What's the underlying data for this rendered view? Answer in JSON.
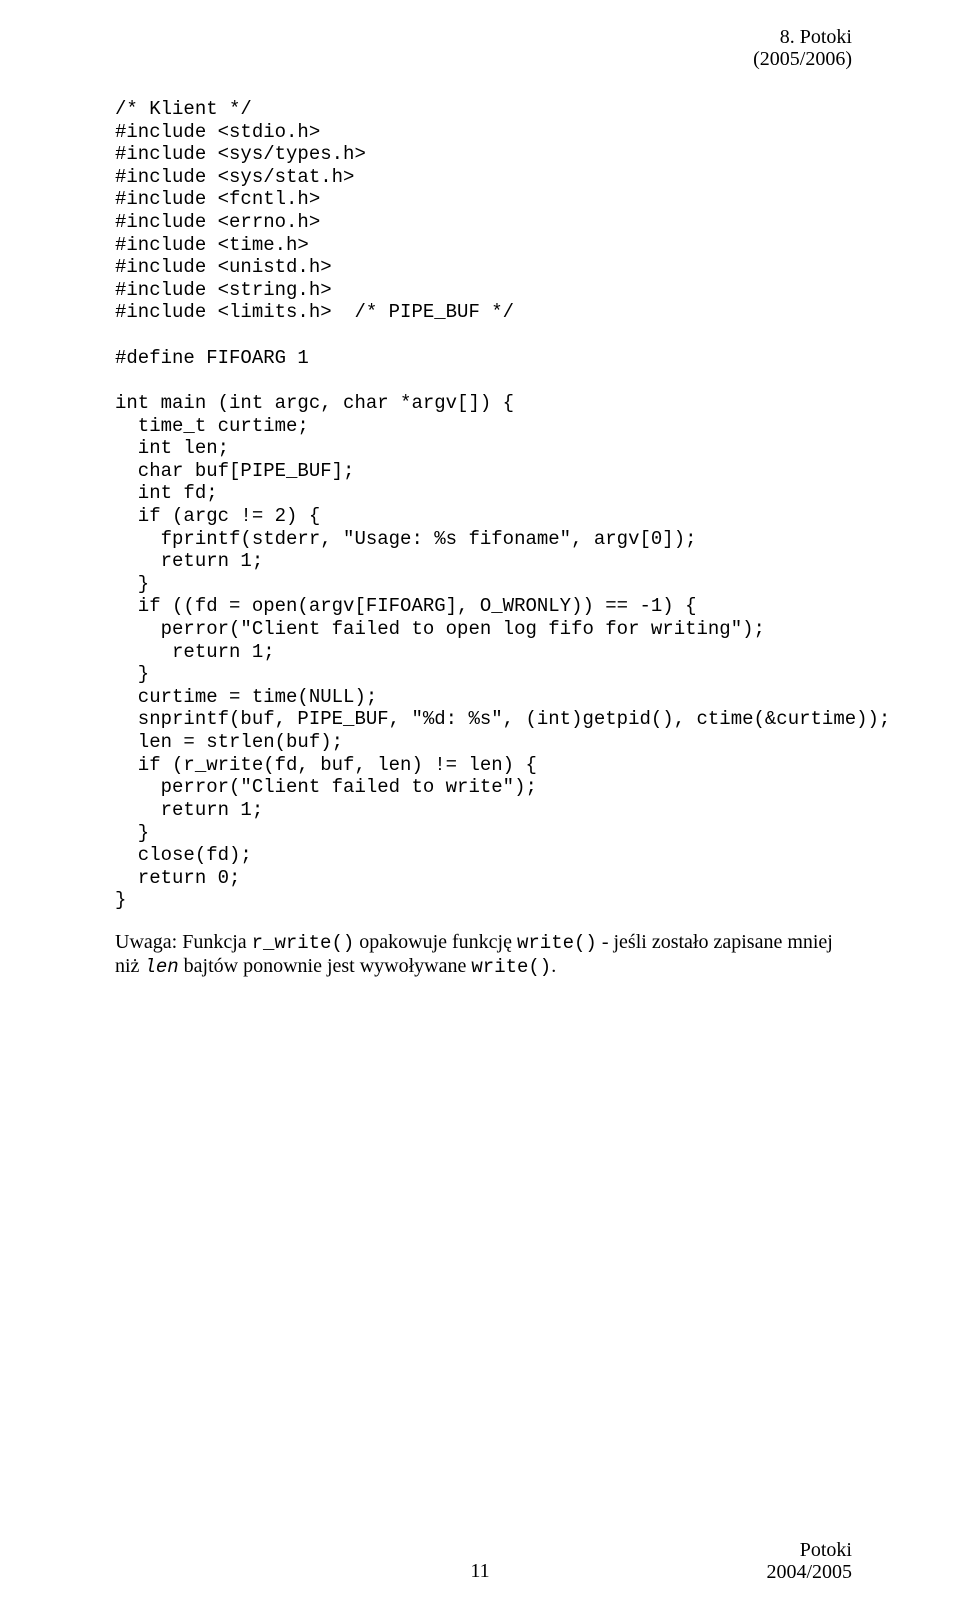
{
  "header": {
    "title": "8. Potoki",
    "year": "(2005/2006)"
  },
  "code": "/* Klient */\n#include <stdio.h>\n#include <sys/types.h>\n#include <sys/stat.h>\n#include <fcntl.h>\n#include <errno.h>\n#include <time.h>\n#include <unistd.h>\n#include <string.h>\n#include <limits.h>  /* PIPE_BUF */\n\n#define FIFOARG 1\n\nint main (int argc, char *argv[]) {\n  time_t curtime;\n  int len;\n  char buf[PIPE_BUF];\n  int fd;\n  if (argc != 2) {\n    fprintf(stderr, \"Usage: %s fifoname\", argv[0]);\n    return 1;\n  }\n  if ((fd = open(argv[FIFOARG], O_WRONLY)) == -1) {\n    perror(\"Client failed to open log fifo for writing\");\n     return 1;\n  }\n  curtime = time(NULL);\n  snprintf(buf, PIPE_BUF, \"%d: %s\", (int)getpid(), ctime(&curtime));\n  len = strlen(buf);\n  if (r_write(fd, buf, len) != len) {\n    perror(\"Client failed to write\");\n    return 1;\n  }\n  close(fd);\n  return 0;\n}",
  "note": {
    "prefix": "Uwaga: Funkcja ",
    "fn1": "r_write()",
    "mid1": " opakowuje funkcję ",
    "fn2": "write()",
    "mid2": " - jeśli zostało zapisane mniej niż ",
    "var": "len",
    "mid3": " bajtów ponownie jest wywoływane ",
    "fn3": "write()",
    "end": "."
  },
  "footer": {
    "page": "11",
    "right1": "Potoki",
    "right2": "2004/2005"
  }
}
